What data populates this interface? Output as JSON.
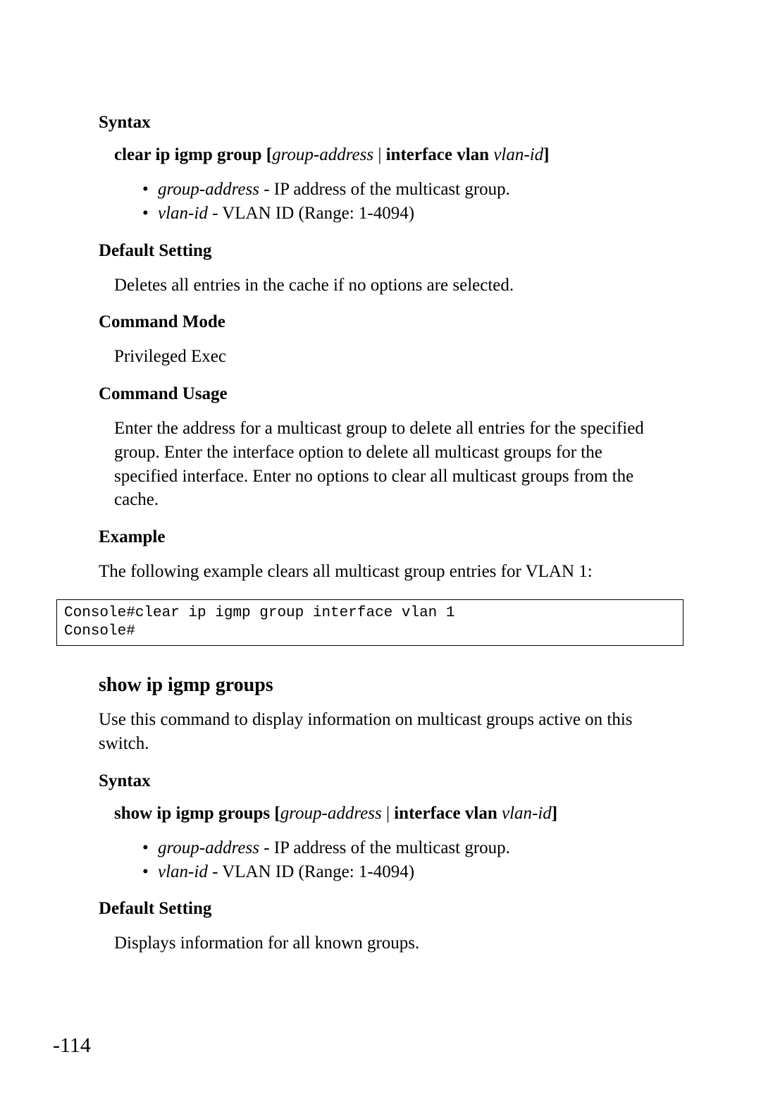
{
  "section1": {
    "syntax_heading": "Syntax",
    "command_bold1": "clear ip igmp group",
    "bracket_open": " [",
    "param1": "group-address",
    "pipe": " | ",
    "command_bold2": "interface vlan",
    "param2": " vlan-id",
    "bracket_close": "]",
    "params": [
      {
        "italic": "group-address",
        "rest": " - IP address of the multicast group."
      },
      {
        "italic": "vlan-id",
        "rest": " - VLAN ID (Range: 1-4094)"
      }
    ],
    "default_heading": "Default Setting",
    "default_text": "Deletes all entries in the cache if no options are selected.",
    "mode_heading": "Command Mode",
    "mode_text": "Privileged Exec",
    "usage_heading": "Command Usage",
    "usage_text": "Enter the address for a multicast group to delete all entries for the specified group. Enter the interface option to delete all multicast groups for the specified interface. Enter no options to clear all multicast groups from the cache.",
    "example_heading": "Example",
    "example_intro": "The following example clears all multicast group entries for VLAN 1:",
    "code": "Console#clear ip igmp group interface vlan 1\nConsole#"
  },
  "section2": {
    "title": "show ip igmp groups",
    "intro": "Use this command to display information on multicast groups active on this switch.",
    "syntax_heading": "Syntax",
    "command_bold1": "show ip igmp groups",
    "bracket_open": " [",
    "param1": "group-address",
    "pipe": " | ",
    "command_bold2": "interface vlan",
    "param2": " vlan-id",
    "bracket_close": "]",
    "params": [
      {
        "italic": "group-address",
        "rest": " - IP address of the multicast group."
      },
      {
        "italic": "vlan-id",
        "rest": " - VLAN ID (Range: 1-4094)"
      }
    ],
    "default_heading": "Default Setting",
    "default_text": "Displays information for all known groups."
  },
  "page_number": "-114"
}
